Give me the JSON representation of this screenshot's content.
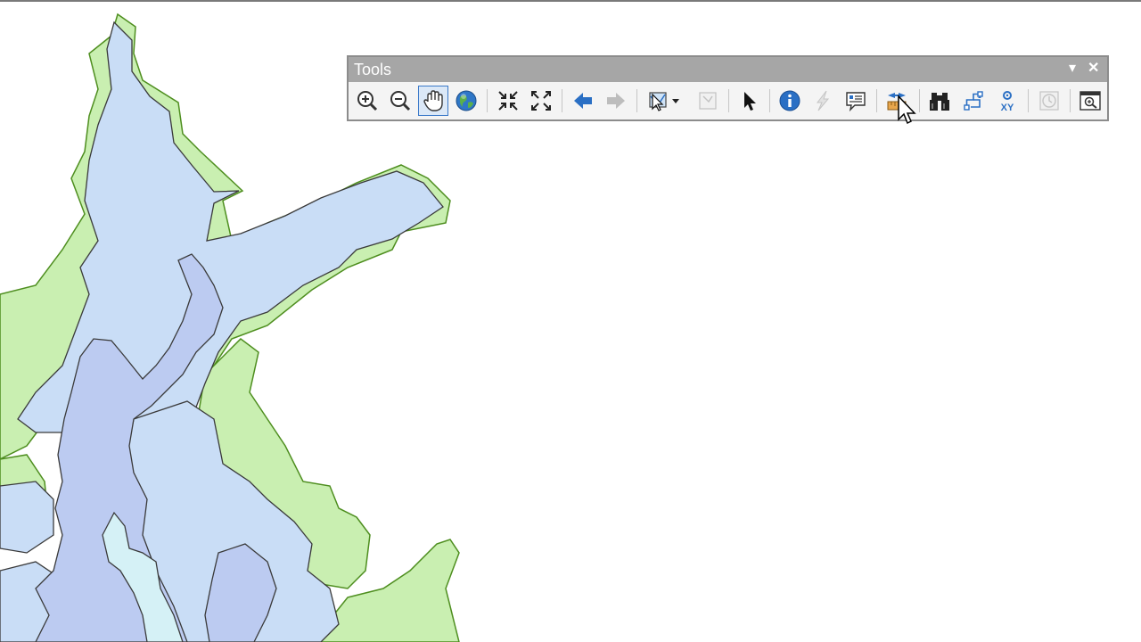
{
  "window": {
    "title": "Tools"
  },
  "toolbar": {
    "menu_label": "▾",
    "close_label": "✕",
    "buttons": [
      {
        "name": "zoom-in-tool",
        "icon": "zoom-in-icon"
      },
      {
        "name": "zoom-out-tool",
        "icon": "zoom-out-icon"
      },
      {
        "name": "pan-tool",
        "icon": "hand-icon",
        "selected": true
      },
      {
        "name": "full-extent-button",
        "icon": "globe-icon"
      },
      {
        "name": "fixed-zoom-in-button",
        "icon": "fixed-zoom-in-icon"
      },
      {
        "name": "fixed-zoom-out-button",
        "icon": "fixed-zoom-out-icon"
      },
      {
        "name": "go-back-button",
        "icon": "arrow-left-icon"
      },
      {
        "name": "go-forward-button",
        "icon": "arrow-right-icon",
        "disabled": true
      },
      {
        "name": "select-features-button",
        "icon": "select-features-icon"
      },
      {
        "name": "clear-selection-button",
        "icon": "clear-selection-icon",
        "disabled": true
      },
      {
        "name": "select-elements-button",
        "icon": "pointer-icon"
      },
      {
        "name": "identify-button",
        "icon": "info-icon"
      },
      {
        "name": "hyperlink-button",
        "icon": "lightning-icon",
        "disabled": true
      },
      {
        "name": "html-popup-button",
        "icon": "html-popup-icon"
      },
      {
        "name": "measure-button",
        "icon": "ruler-icon"
      },
      {
        "name": "find-button",
        "icon": "binoculars-icon"
      },
      {
        "name": "find-route-button",
        "icon": "route-icon"
      },
      {
        "name": "go-to-xy-button",
        "icon": "xy-icon"
      },
      {
        "name": "time-slider-button",
        "icon": "clock-icon",
        "disabled": true
      },
      {
        "name": "viewer-button",
        "icon": "viewer-icon"
      }
    ],
    "xy_text": "XY"
  },
  "colors": {
    "title_bar": "#a6a6a6",
    "land_green": "#c9efb1",
    "water_light": "#c9ddf6",
    "water_mid": "#bccbf1",
    "water_deep": "#d5f1f6",
    "accent_blue": "#2a6fc4"
  }
}
